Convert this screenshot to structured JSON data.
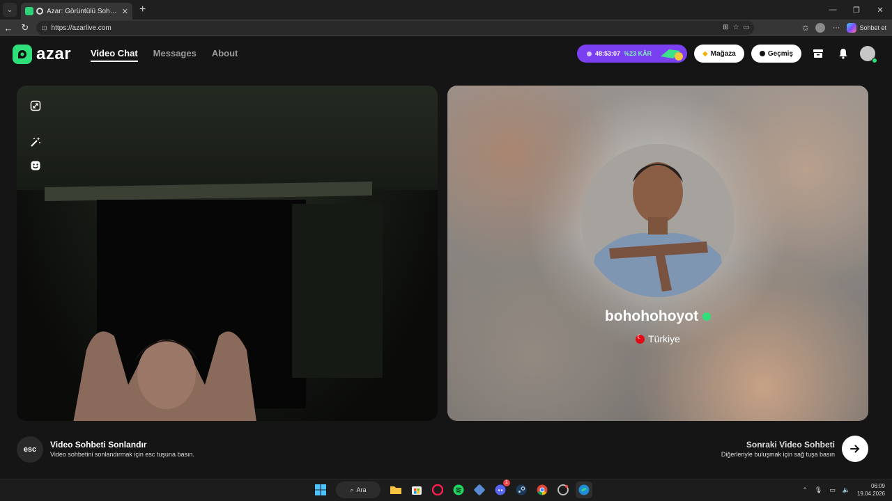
{
  "browser": {
    "tab_title": "Azar: Görüntülü Sohbet & Yer",
    "tab_close": "✕",
    "new_tab": "+",
    "url": "https://azarlive.com",
    "copilot_label": "Sohbet et",
    "window_controls": [
      "—",
      "❐",
      "✕"
    ]
  },
  "app": {
    "brand": "azar",
    "nav": [
      {
        "label": "Video Chat",
        "active": true
      },
      {
        "label": "Messages",
        "active": false
      },
      {
        "label": "About",
        "active": false
      }
    ],
    "promo": {
      "timer": "48:53:07",
      "discount": "%23 KÂR"
    },
    "store_label": "Mağaza",
    "history_label": "Geçmiş"
  },
  "peer": {
    "name": "bohohohoyot",
    "country": "Türkiye"
  },
  "controls": {
    "esc_key": "esc",
    "end_title": "Video Sohbeti Sonlandır",
    "end_desc": "Video sohbetini sonlandırmak için esc tuşuna basın.",
    "next_title": "Sonraki Video Sohbeti",
    "next_desc": "Diğerleriyle buluşmak için sağ tuşa basın"
  },
  "taskbar": {
    "search_label": "Ara",
    "time": "06:09",
    "date": "19.04.2026",
    "discord_badge": "1"
  },
  "colors": {
    "accent_green": "#2fe07a",
    "promo_purple": "#7b3ff2",
    "background": "#151515"
  }
}
